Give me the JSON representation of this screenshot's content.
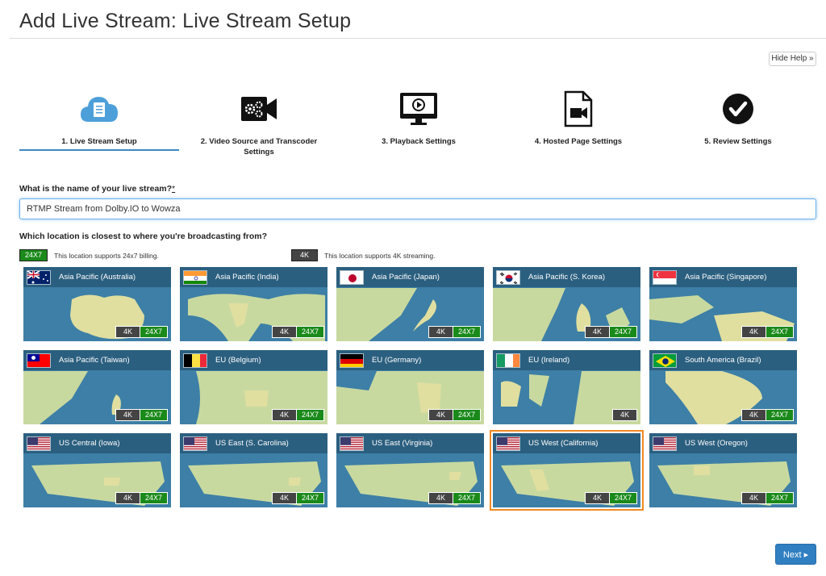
{
  "page": {
    "title": "Add Live Stream: Live Stream Setup",
    "hide_help": "Hide Help »"
  },
  "steps": [
    {
      "label": "1. Live Stream Setup",
      "icon": "cloud-document-icon",
      "active": true
    },
    {
      "label": "2. Video Source and Transcoder Settings",
      "icon": "video-camera-gear-icon",
      "active": false
    },
    {
      "label": "3. Playback Settings",
      "icon": "monitor-play-icon",
      "active": false
    },
    {
      "label": "4. Hosted Page Settings",
      "icon": "video-file-icon",
      "active": false
    },
    {
      "label": "5. Review Settings",
      "icon": "check-circle-icon",
      "active": false
    }
  ],
  "form": {
    "name_question": "What is the name of your live stream?",
    "required_mark": "*",
    "name_value": "RTMP Stream from Dolby.IO to Wowza",
    "location_question": "Which location is closest to where you're broadcasting from?"
  },
  "legend": {
    "badge_247": "24X7",
    "text_247": "This location supports 24x7 billing.",
    "badge_4k": "4K",
    "text_4k": "This location supports 4K streaming."
  },
  "badges": {
    "k4": "4K",
    "b247": "24X7"
  },
  "locations": [
    {
      "name": "Asia Pacific (Australia)",
      "flag": "australia-flag",
      "k4": true,
      "b247": true,
      "selected": false
    },
    {
      "name": "Asia Pacific (India)",
      "flag": "india-flag",
      "k4": true,
      "b247": true,
      "selected": false
    },
    {
      "name": "Asia Pacific (Japan)",
      "flag": "japan-flag",
      "k4": true,
      "b247": true,
      "selected": false
    },
    {
      "name": "Asia Pacific (S. Korea)",
      "flag": "south-korea-flag",
      "k4": true,
      "b247": true,
      "selected": false
    },
    {
      "name": "Asia Pacific (Singapore)",
      "flag": "singapore-flag",
      "k4": true,
      "b247": true,
      "selected": false
    },
    {
      "name": "Asia Pacific (Taiwan)",
      "flag": "taiwan-flag",
      "k4": true,
      "b247": true,
      "selected": false
    },
    {
      "name": "EU (Belgium)",
      "flag": "belgium-flag",
      "k4": true,
      "b247": true,
      "selected": false
    },
    {
      "name": "EU (Germany)",
      "flag": "germany-flag",
      "k4": true,
      "b247": true,
      "selected": false
    },
    {
      "name": "EU (Ireland)",
      "flag": "ireland-flag",
      "k4": true,
      "b247": false,
      "selected": false
    },
    {
      "name": "South America (Brazil)",
      "flag": "brazil-flag",
      "k4": true,
      "b247": true,
      "selected": false
    },
    {
      "name": "US Central (Iowa)",
      "flag": "usa-flag",
      "k4": true,
      "b247": true,
      "selected": false
    },
    {
      "name": "US East (S. Carolina)",
      "flag": "usa-flag",
      "k4": true,
      "b247": true,
      "selected": false
    },
    {
      "name": "US East (Virginia)",
      "flag": "usa-flag",
      "k4": true,
      "b247": true,
      "selected": false
    },
    {
      "name": "US West (California)",
      "flag": "usa-flag",
      "k4": true,
      "b247": true,
      "selected": true
    },
    {
      "name": "US West (Oregon)",
      "flag": "usa-flag",
      "k4": true,
      "b247": true,
      "selected": false
    }
  ],
  "footer": {
    "next_label": "Next ▸"
  },
  "colors": {
    "accent": "#3a88c8",
    "badge_247": "#1a8a1a",
    "badge_4k": "#444444",
    "selected_outline": "#f08a24",
    "next_button": "#2f7fc1"
  }
}
